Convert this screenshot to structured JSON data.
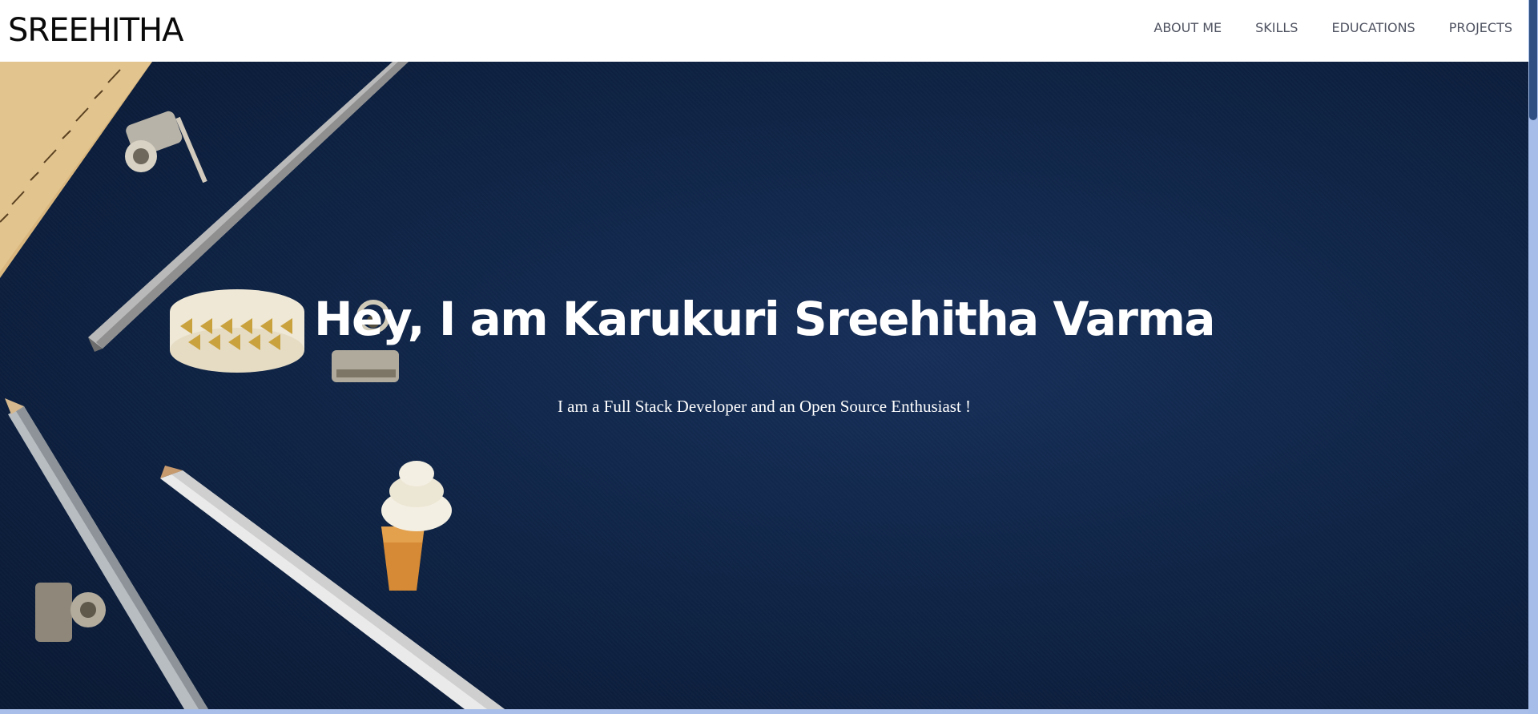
{
  "header": {
    "brand": "SREEHITHA",
    "nav": [
      {
        "label": "ABOUT ME"
      },
      {
        "label": "SKILLS"
      },
      {
        "label": "EDUCATIONS"
      },
      {
        "label": "PROJECTS"
      }
    ]
  },
  "hero": {
    "title": "Hey, I am Karukuri Sreehitha Varma",
    "subtitle": "I am a Full Stack Developer and an Open Source Enthusiast !",
    "background_color": "#102649"
  },
  "colors": {
    "nav_text": "#4f5361",
    "brand_text": "#0a0a0a",
    "scrollbar_track": "#a6bde9",
    "scrollbar_thumb": "#2f4f82"
  }
}
